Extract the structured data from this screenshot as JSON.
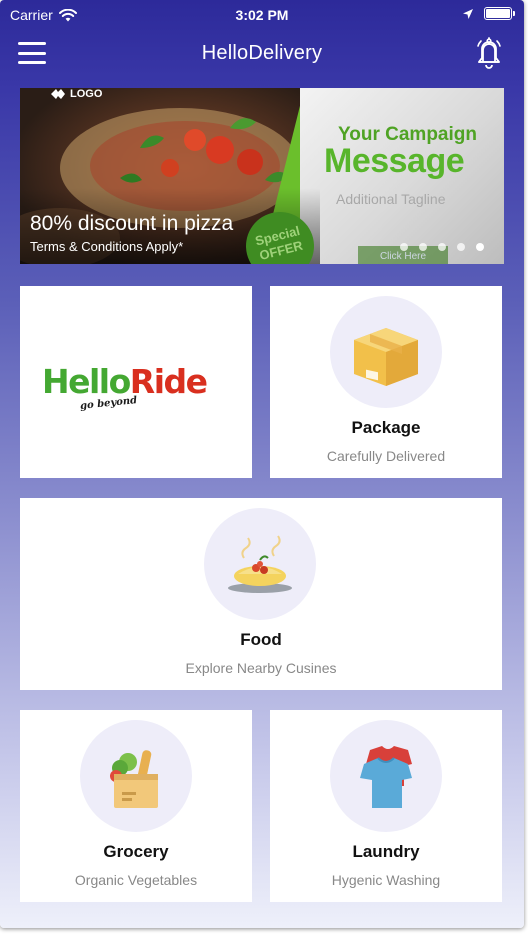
{
  "status_bar": {
    "carrier": "Carrier",
    "time": "3:02 PM",
    "battery_level": 1.0
  },
  "navbar": {
    "title": "HelloDelivery",
    "menu_icon": "hamburger-menu-icon",
    "notification_icon": "bell-icon"
  },
  "banner": {
    "logo_label": "LOGO",
    "campaign_line1": "Your Campaign",
    "campaign_line2": "Message",
    "campaign_tagline": "Additional Tagline",
    "badge_line1": "Special",
    "badge_line2": "OFFER",
    "click_label": "Click Here",
    "caption": "80% discount in pizza",
    "subcaption": "Terms & Conditions Apply*",
    "dot_count": 5,
    "active_dot_index": 4
  },
  "services": {
    "helloride": {
      "brand_part1": "Hello",
      "brand_part2": "Ride",
      "tagline": "go beyond"
    },
    "package": {
      "title": "Package",
      "subtitle": "Carefully Delivered",
      "icon": "package-box-icon"
    },
    "food": {
      "title": "Food",
      "subtitle": "Explore Nearby Cusines",
      "icon": "food-plate-icon"
    },
    "grocery": {
      "title": "Grocery",
      "subtitle": "Organic Vegetables",
      "icon": "grocery-bag-icon"
    },
    "laundry": {
      "title": "Laundry",
      "subtitle": "Hygenic Washing",
      "icon": "laundry-clothes-icon"
    }
  },
  "colors": {
    "header_top": "#2d2a9a",
    "gradient_bottom": "#eef0fa",
    "brand_green": "#44a832",
    "brand_red": "#d92f1f",
    "icon_circle": "#eeedf9"
  }
}
